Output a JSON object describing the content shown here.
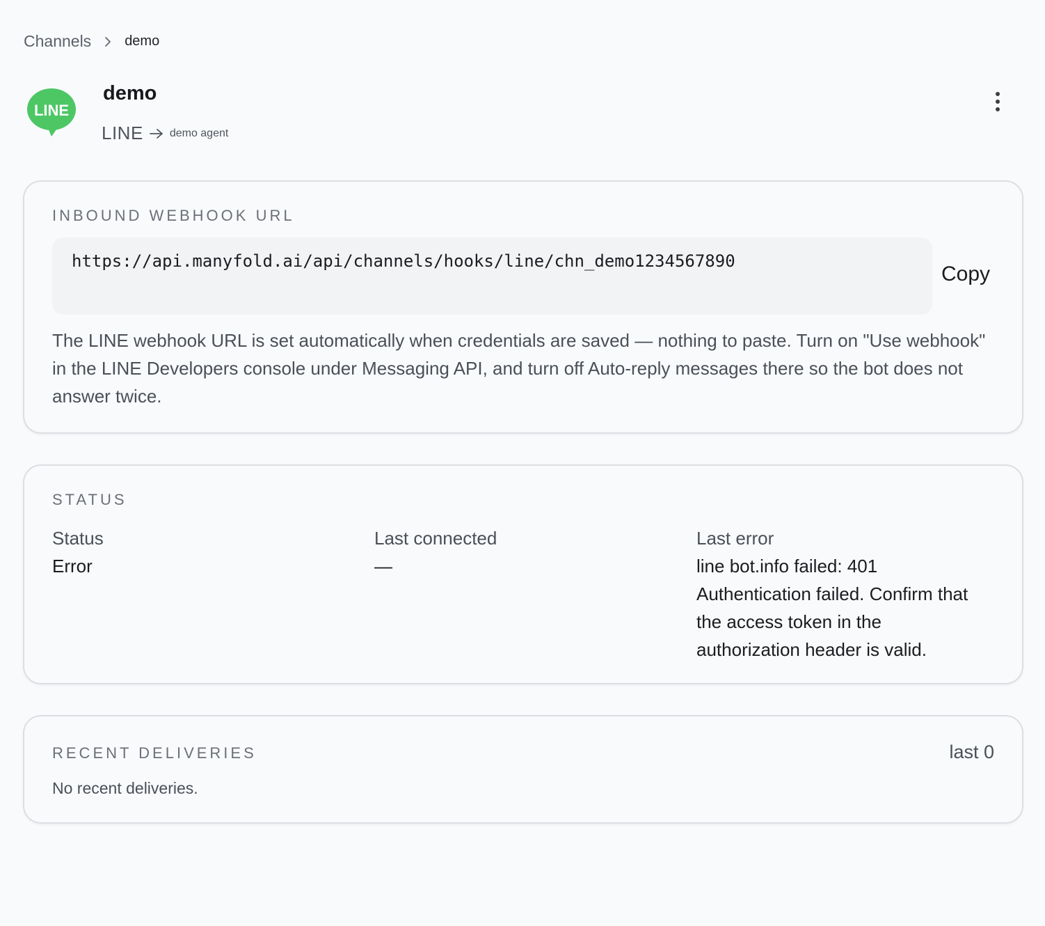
{
  "breadcrumb": {
    "root": "Channels",
    "current": "demo"
  },
  "header": {
    "logo_text": "LINE",
    "title": "demo",
    "channel_type": "LINE",
    "agent": "demo agent"
  },
  "webhook": {
    "heading": "INBOUND WEBHOOK URL",
    "url": "https://api.manyfold.ai/api/channels/hooks/line/chn_demo1234567890",
    "copy_label": "Copy",
    "help_text": "The LINE webhook URL is set automatically when credentials are saved — nothing to paste. Turn on \"Use webhook\" in the LINE Developers console under Messaging API, and turn off Auto-reply messages there so the bot does not answer twice."
  },
  "status": {
    "heading": "STATUS",
    "status_label": "Status",
    "status_value": "Error",
    "last_connected_label": "Last connected",
    "last_connected_value": "—",
    "last_error_label": "Last error",
    "last_error_value": "line bot.info failed: 401 Authentication failed. Confirm that the access token in the authorization header is valid."
  },
  "deliveries": {
    "heading": "RECENT DELIVERIES",
    "count_label": "last 0",
    "empty_text": "No recent deliveries."
  },
  "colors": {
    "line_green": "#4cc764",
    "background": "#f9fafc",
    "card_border": "#dcdee3"
  },
  "icons": [
    "line-logo-icon",
    "chevron-right-icon",
    "arrow-right-icon",
    "more-vertical-icon"
  ]
}
